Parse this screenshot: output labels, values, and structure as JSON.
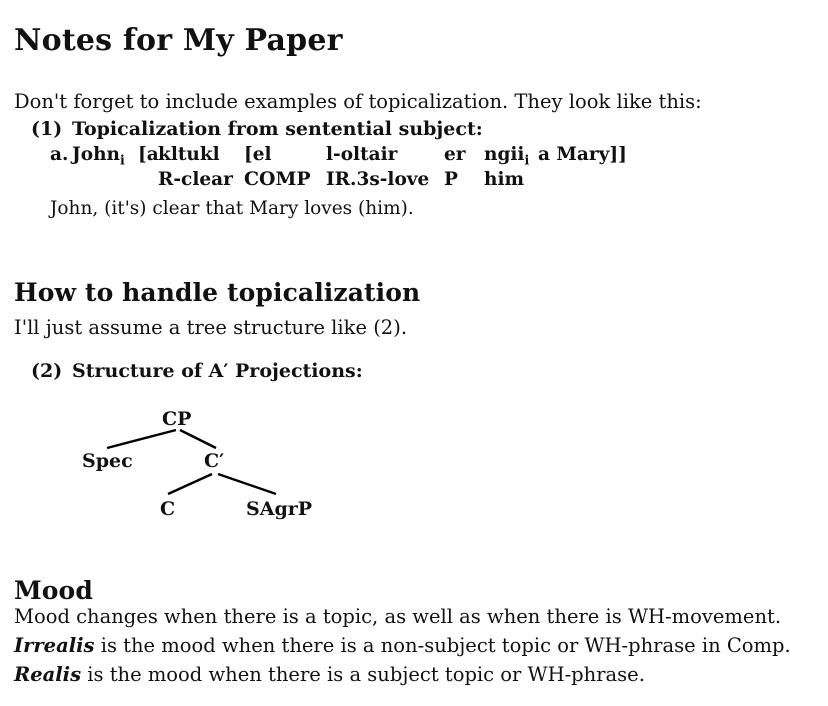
{
  "document": {
    "title": "Notes for My Paper",
    "intro": "Don't forget to include examples of topicalization.  They look like this:"
  },
  "sections": {
    "handle": {
      "heading": "How to handle topicalization",
      "assume_line": "I'll just assume a tree structure like (2)."
    },
    "mood": {
      "heading": "Mood",
      "lines": {
        "line1": "Mood changes when there is a topic, as well as when there is WH-movement.",
        "line2_term": "Irrealis",
        "line2_rest": " is the mood when there is a non-subject topic or WH-phrase in Comp.",
        "line3_term": "Realis",
        "line3_rest": " is the mood when there is a subject topic or WH-phrase."
      }
    }
  },
  "examples": {
    "one": {
      "number": "(1)",
      "title": "Topicalization from sentential subject:",
      "object_line": {
        "letter": "a.",
        "john": "John",
        "john_sub": "i",
        "bracket_a": "[a",
        "kltukl": "kltukl",
        "el": "[el",
        "altair": "l-oltair",
        "er": "er",
        "ngii": "ngii",
        "ngii_sub": "i",
        "amary": "a Mary]]"
      },
      "gloss_line": {
        "rclear": "R-clear",
        "comp": "COMP",
        "ir3s": "IR.3s-love",
        "p": "P",
        "him": "him"
      },
      "free_line": "John, (it's) clear that Mary loves (him)."
    },
    "two": {
      "number": "(2)",
      "title": "Structure of A′ Projections:"
    }
  },
  "tree": {
    "nodes": {
      "cp": "CP",
      "spec": "Spec",
      "cbar": "C′",
      "c": "C",
      "sagrp": "SAgrP"
    }
  },
  "colors": {
    "background": "#ffffff",
    "text": "#111111",
    "rule": "#000000"
  }
}
